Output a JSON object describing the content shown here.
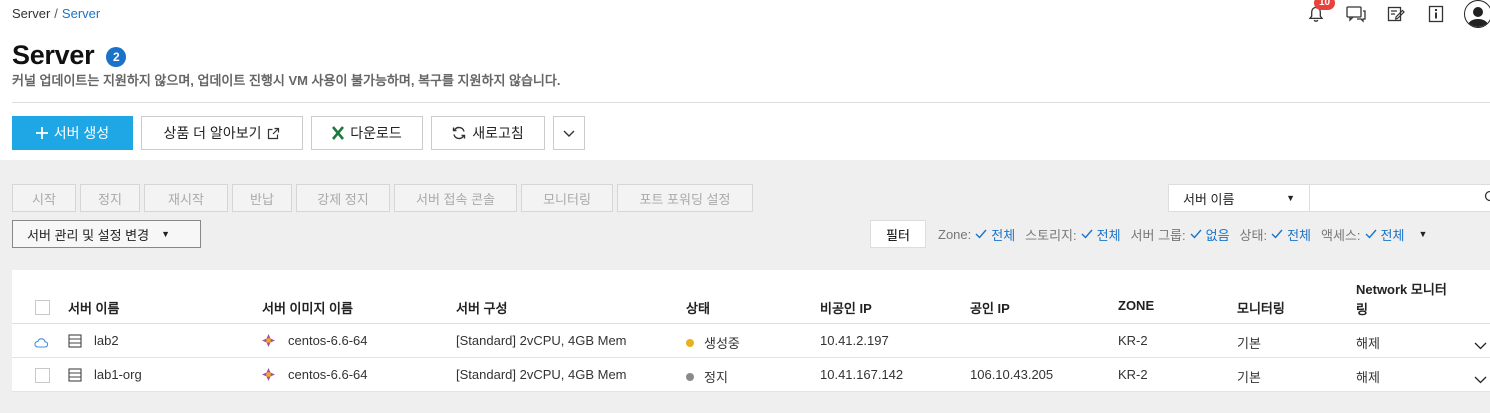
{
  "breadcrumb": {
    "root": "Server",
    "sep": "/",
    "current": "Server"
  },
  "notifications": {
    "count": "10"
  },
  "page": {
    "title": "Server",
    "count": "2",
    "subtitle": "커널 업데이트는 지원하지 않으며, 업데이트 진행시 VM 사용이 불가능하며, 복구를 지원하지 않습니다."
  },
  "actions": {
    "create": "서버 생성",
    "learn_more": "상품 더 알아보기",
    "download": "다운로드",
    "refresh": "새로고침"
  },
  "operations": [
    "시작",
    "정지",
    "재시작",
    "반납",
    "강제 정지",
    "서버 접속 콘솔",
    "모니터링",
    "포트 포워딩 설정"
  ],
  "manage_menu": "서버 관리 및 설정 변경",
  "search": {
    "field": "서버 이름",
    "value": ""
  },
  "filter": {
    "button": "필터",
    "items": [
      {
        "label": "Zone:",
        "value": "전체"
      },
      {
        "label": "스토리지:",
        "value": "전체"
      },
      {
        "label": "서버 그룹:",
        "value": "없음"
      },
      {
        "label": "상태:",
        "value": "전체"
      },
      {
        "label": "액세스:",
        "value": "전체"
      }
    ]
  },
  "table": {
    "headers": [
      "서버 이름",
      "서버 이미지 이름",
      "서버 구성",
      "상태",
      "비공인 IP",
      "공인 IP",
      "ZONE",
      "모니터링",
      "Network 모니터",
      "링"
    ],
    "rows": [
      {
        "name": "lab2",
        "image": "centos-6.6-64",
        "spec": "[Standard] 2vCPU, 4GB Mem",
        "status": "생성중",
        "status_color": "#e8b21a",
        "private_ip": "10.41.2.197",
        "public_ip": "",
        "zone": "KR-2",
        "monitoring": "기본",
        "net_monitoring": "해제"
      },
      {
        "name": "lab1-org",
        "image": "centos-6.6-64",
        "spec": "[Standard] 2vCPU, 4GB Mem",
        "status": "정지",
        "status_color": "#8a8a8a",
        "private_ip": "10.41.167.142",
        "public_ip": "106.10.43.205",
        "zone": "KR-2",
        "monitoring": "기본",
        "net_monitoring": "해제"
      }
    ]
  }
}
